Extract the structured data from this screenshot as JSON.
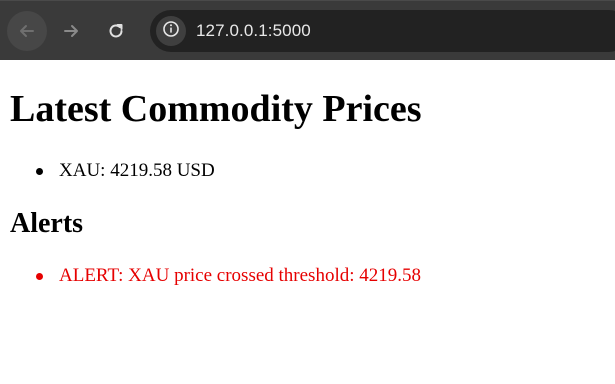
{
  "browser": {
    "url": "127.0.0.1:5000",
    "icons": [
      "back-arrow-icon",
      "forward-arrow-icon",
      "reload-icon",
      "site-info-icon"
    ]
  },
  "page": {
    "title": "Latest Commodity Prices",
    "prices": [
      {
        "text": "XAU: 4219.58 USD"
      }
    ],
    "alerts_title": "Alerts",
    "alerts": [
      {
        "text": "ALERT: XAU price crossed threshold: 4219.58",
        "color": "#e60000"
      }
    ]
  }
}
